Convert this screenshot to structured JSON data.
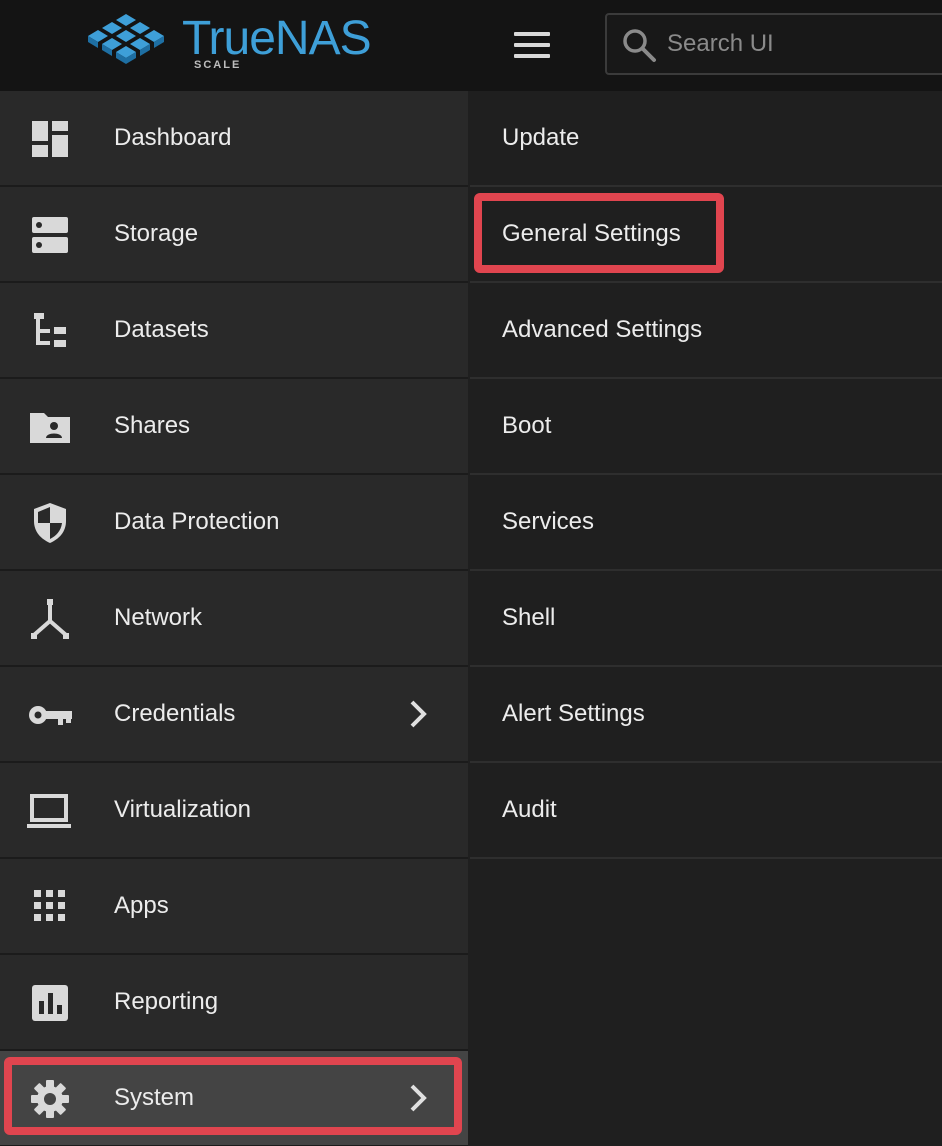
{
  "app": {
    "logo_text": "TrueNAS",
    "logo_subtitle": "SCALE",
    "brand_color": "#3e9fd8",
    "highlight_color": "#e0454f"
  },
  "header": {
    "menu_icon": "hamburger-menu-icon",
    "search": {
      "placeholder": "Search UI",
      "value": "",
      "icon": "search-icon"
    }
  },
  "sidebar": {
    "items": [
      {
        "label": "Dashboard",
        "icon": "dashboard-icon"
      },
      {
        "label": "Storage",
        "icon": "storage-icon"
      },
      {
        "label": "Datasets",
        "icon": "datasets-icon"
      },
      {
        "label": "Shares",
        "icon": "shares-folder-icon"
      },
      {
        "label": "Data Protection",
        "icon": "shield-icon"
      },
      {
        "label": "Network",
        "icon": "network-icon"
      },
      {
        "label": "Credentials",
        "icon": "key-icon",
        "has_submenu": true
      },
      {
        "label": "Virtualization",
        "icon": "laptop-icon"
      },
      {
        "label": "Apps",
        "icon": "apps-grid-icon"
      },
      {
        "label": "Reporting",
        "icon": "bar-chart-icon"
      },
      {
        "label": "System",
        "icon": "gear-icon",
        "has_submenu": true,
        "active": true
      }
    ]
  },
  "submenu": {
    "items": [
      {
        "label": "Update"
      },
      {
        "label": "General Settings",
        "active": true
      },
      {
        "label": "Advanced Settings"
      },
      {
        "label": "Boot"
      },
      {
        "label": "Services"
      },
      {
        "label": "Shell"
      },
      {
        "label": "Alert Settings"
      },
      {
        "label": "Audit"
      }
    ]
  }
}
